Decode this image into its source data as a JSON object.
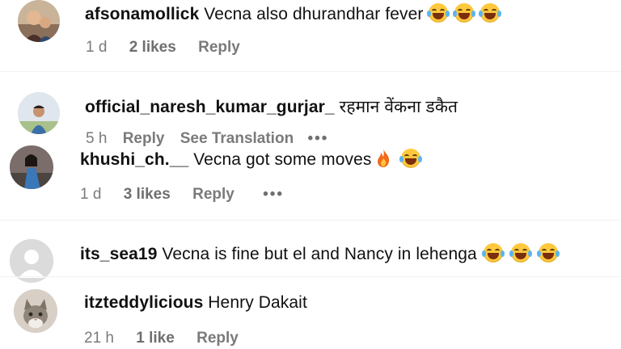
{
  "comments": [
    {
      "username": "afsonamollick",
      "text": "Vecna also dhurandhar fever",
      "emojis": [
        "laughing-emoji",
        "laughing-emoji",
        "laughing-emoji"
      ],
      "time": "1 d",
      "likes": "2 likes",
      "reply": "Reply"
    },
    {
      "username": "official_naresh_kumar_gurjar_",
      "text": "रहमान वेंकना डकैत",
      "time": "5 h",
      "reply": "Reply",
      "translation": "See Translation",
      "more": "•••"
    },
    {
      "username": "khushi_ch.__",
      "text": "Vecna got some moves",
      "emojis": [
        "fire-emoji",
        "laughing-emoji"
      ],
      "time": "1 d",
      "likes": "3 likes",
      "reply": "Reply",
      "more": "•••"
    },
    {
      "username": "its_sea19",
      "text": "Vecna is fine but el and Nancy in lehenga",
      "emojis": [
        "laughing-emoji",
        "laughing-emoji",
        "laughing-emoji"
      ]
    },
    {
      "username": "itzteddylicious",
      "text": "Henry Dakait",
      "time": "21 h",
      "likes": "1 like",
      "reply": "Reply"
    }
  ],
  "colors": {
    "username": "#111111",
    "meta": "#7a7a7a",
    "emoji": "#ffc83d"
  }
}
